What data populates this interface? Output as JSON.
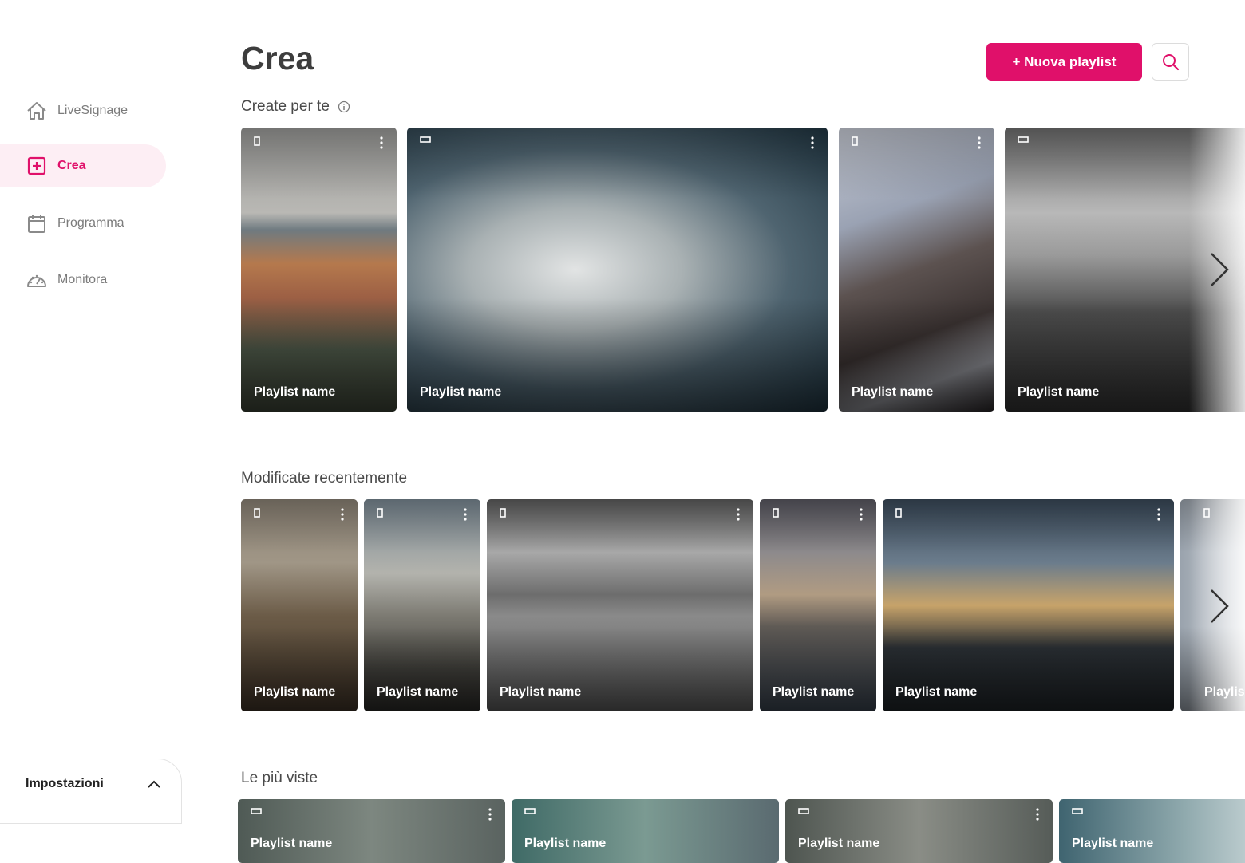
{
  "sidebar": {
    "items": [
      {
        "label": "LiveSignage",
        "icon": "home-icon"
      },
      {
        "label": "Crea",
        "icon": "add-square-icon",
        "active": true
      },
      {
        "label": "Programma",
        "icon": "calendar-icon"
      },
      {
        "label": "Monitora",
        "icon": "gauge-icon"
      }
    ],
    "settings_label": "Impostazioni"
  },
  "header": {
    "title": "Crea",
    "new_playlist_label": "+ Nuova playlist"
  },
  "colors": {
    "accent": "#e0106a",
    "accent_bg": "#fdeef4"
  },
  "sections": [
    {
      "title": "Create per te",
      "cards": [
        {
          "name": "Playlist name",
          "orientation": "portrait"
        },
        {
          "name": "Playlist name",
          "orientation": "landscape"
        },
        {
          "name": "Playlist name",
          "orientation": "portrait"
        },
        {
          "name": "Playlist name",
          "orientation": "landscape"
        }
      ]
    },
    {
      "title": "Modificate recentemente",
      "cards": [
        {
          "name": "Playlist name",
          "orientation": "portrait"
        },
        {
          "name": "Playlist name",
          "orientation": "portrait"
        },
        {
          "name": "Playlist name",
          "orientation": "portrait"
        },
        {
          "name": "Playlist name",
          "orientation": "portrait"
        },
        {
          "name": "Playlist name",
          "orientation": "portrait"
        },
        {
          "name": "Playlist name",
          "orientation": "portrait"
        }
      ]
    },
    {
      "title": "Le più viste",
      "cards": [
        {
          "name": "Playlist name",
          "orientation": "landscape"
        },
        {
          "name": "Playlist name",
          "orientation": "landscape"
        },
        {
          "name": "Playlist name",
          "orientation": "landscape"
        },
        {
          "name": "Playlist name",
          "orientation": "landscape"
        }
      ]
    }
  ]
}
